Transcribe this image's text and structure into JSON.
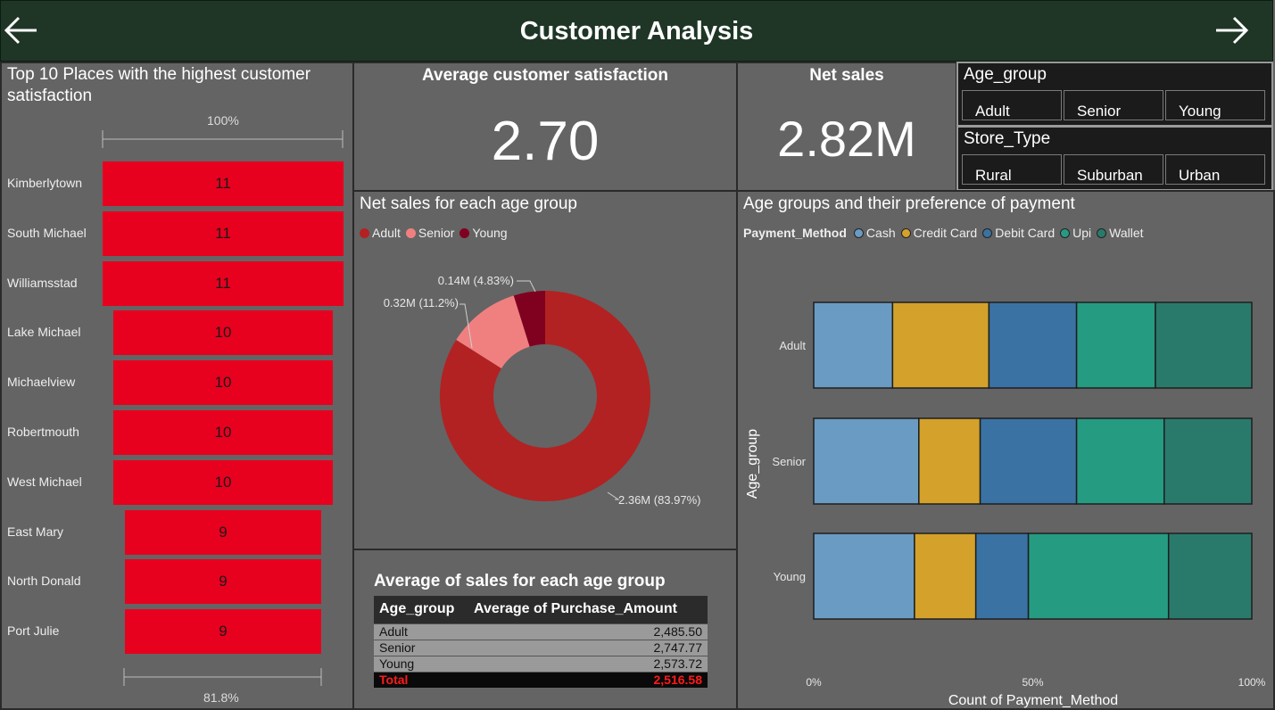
{
  "header": {
    "title": "Customer Analysis"
  },
  "left_panel": {
    "title": "Top 10 Places with the highest customer satisfaction",
    "top_axis_label": "100%",
    "bottom_axis_label": "81.8%",
    "places": [
      {
        "name": "Kimberlytown",
        "value": "11"
      },
      {
        "name": "South Michael",
        "value": "11"
      },
      {
        "name": "Williamsstad",
        "value": "11"
      },
      {
        "name": "Lake Michael",
        "value": "10"
      },
      {
        "name": "Michaelview",
        "value": "10"
      },
      {
        "name": "Robertmouth",
        "value": "10"
      },
      {
        "name": "West Michael",
        "value": "10"
      },
      {
        "name": "East Mary",
        "value": "9"
      },
      {
        "name": "North Donald",
        "value": "9"
      },
      {
        "name": "Port Julie",
        "value": "9"
      }
    ],
    "bar_color": "#e8001f"
  },
  "avg_card": {
    "title": "Average customer satisfaction",
    "value": "2.70"
  },
  "net_card": {
    "title": "Net sales",
    "value": "2.82M"
  },
  "age_slicer": {
    "title": "Age_group",
    "options": [
      "Adult",
      "Senior",
      "Young"
    ]
  },
  "store_slicer": {
    "title": "Store_Type",
    "options": [
      "Rural",
      "Suburban",
      "Urban"
    ]
  },
  "donut": {
    "title": "Net sales for each age group",
    "legend": [
      {
        "label": "Adult",
        "color": "#b22222"
      },
      {
        "label": "Senior",
        "color": "#f08080"
      },
      {
        "label": "Young",
        "color": "#800020"
      }
    ],
    "labels": {
      "adult": "2.36M (83.97%)",
      "senior": "0.32M (11.2%)",
      "young": "0.14M (4.83%)"
    }
  },
  "avg_table": {
    "title": "Average of sales for each age group",
    "headers": [
      "Age_group",
      "Average of Purchase_Amount"
    ],
    "rows": [
      [
        "Adult",
        "2,485.50"
      ],
      [
        "Senior",
        "2,747.77"
      ],
      [
        "Young",
        "2,573.72"
      ]
    ],
    "total": [
      "Total",
      "2,516.58"
    ]
  },
  "stacked": {
    "title": "Age groups and their preference of payment",
    "legend_title": "Payment_Method",
    "legend": [
      {
        "label": "Cash",
        "color": "#6a9bc3"
      },
      {
        "label": "Credit Card",
        "color": "#d4a12b"
      },
      {
        "label": "Debit Card",
        "color": "#3a72a3"
      },
      {
        "label": "Upi",
        "color": "#259b82"
      },
      {
        "label": "Wallet",
        "color": "#2a7a6c"
      }
    ],
    "y_title": "Age_group",
    "x_title": "Count of Payment_Method",
    "x_ticks": [
      "0%",
      "50%",
      "100%"
    ]
  },
  "chart_data": [
    {
      "type": "bar",
      "title": "Top 10 Places with the highest customer satisfaction",
      "categories": [
        "Kimberlytown",
        "South Michael",
        "Williamsstad",
        "Lake Michael",
        "Michaelview",
        "Robertmouth",
        "West Michael",
        "East Mary",
        "North Donald",
        "Port Julie"
      ],
      "values": [
        11,
        11,
        11,
        10,
        10,
        10,
        10,
        9,
        9,
        9
      ],
      "axis_labels": [
        "100%",
        "81.8%"
      ]
    },
    {
      "type": "pie",
      "title": "Net sales for each age group",
      "categories": [
        "Adult",
        "Senior",
        "Young"
      ],
      "values": [
        83.97,
        11.2,
        4.83
      ]
    },
    {
      "type": "bar",
      "title": "Age groups and their preference of payment",
      "categories": [
        "Adult",
        "Senior",
        "Young"
      ],
      "series": [
        {
          "name": "Cash",
          "values": [
            18,
            24,
            23
          ]
        },
        {
          "name": "Credit Card",
          "values": [
            22,
            14,
            14
          ]
        },
        {
          "name": "Debit Card",
          "values": [
            20,
            22,
            12
          ]
        },
        {
          "name": "Upi",
          "values": [
            18,
            20,
            32
          ]
        },
        {
          "name": "Wallet",
          "values": [
            22,
            20,
            19
          ]
        }
      ],
      "xlabel": "Count of Payment_Method",
      "ylabel": "Age_group",
      "xlim": [
        0,
        100
      ]
    }
  ]
}
